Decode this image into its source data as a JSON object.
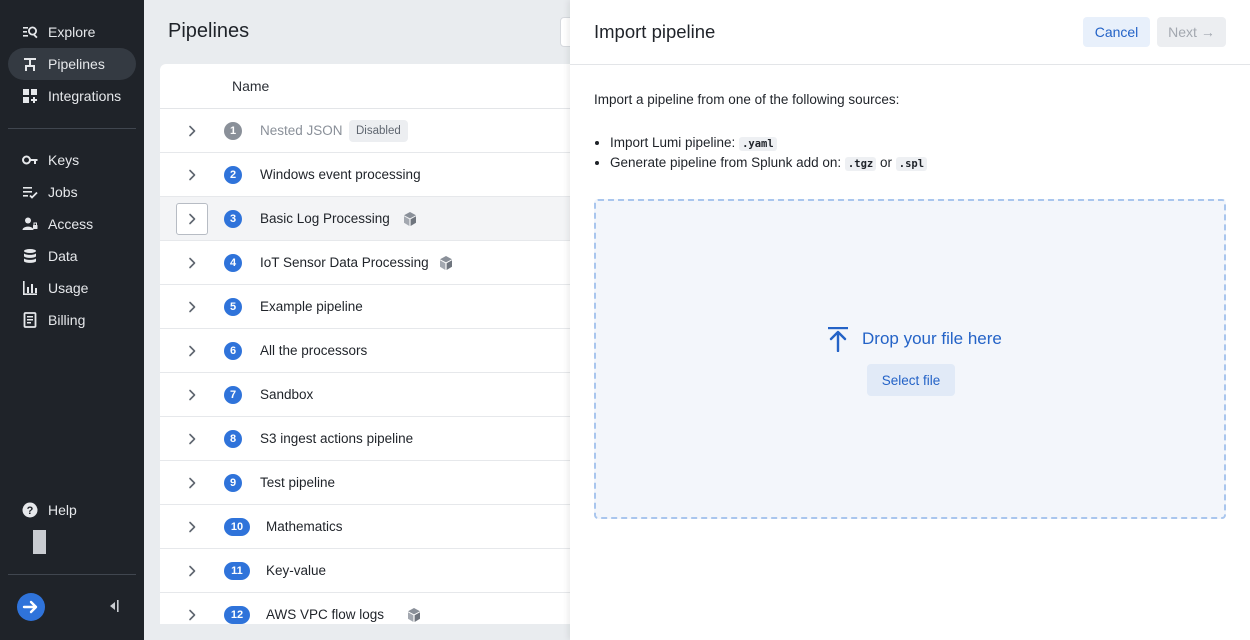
{
  "sidebar": {
    "items": [
      {
        "label": "Explore",
        "icon": "explore-icon"
      },
      {
        "label": "Pipelines",
        "icon": "pipelines-icon",
        "active": true
      },
      {
        "label": "Integrations",
        "icon": "integrations-icon"
      },
      {
        "label": "Keys",
        "icon": "key-icon"
      },
      {
        "label": "Jobs",
        "icon": "jobs-icon"
      },
      {
        "label": "Access",
        "icon": "access-icon"
      },
      {
        "label": "Data",
        "icon": "database-icon"
      },
      {
        "label": "Usage",
        "icon": "bar-chart-icon"
      },
      {
        "label": "Billing",
        "icon": "billing-icon"
      }
    ],
    "help_label": "Help"
  },
  "main": {
    "title": "Pipelines",
    "table": {
      "column_name": "Name",
      "disabled_badge": "Disabled",
      "rows": [
        {
          "num": "1",
          "name": "Nested JSON",
          "disabled": true
        },
        {
          "num": "2",
          "name": "Windows event processing"
        },
        {
          "num": "3",
          "name": "Basic Log Processing",
          "cube": true
        },
        {
          "num": "4",
          "name": "IoT Sensor Data Processing",
          "cube": true
        },
        {
          "num": "5",
          "name": "Example pipeline"
        },
        {
          "num": "6",
          "name": "All the processors"
        },
        {
          "num": "7",
          "name": "Sandbox"
        },
        {
          "num": "8",
          "name": "S3 ingest actions pipeline"
        },
        {
          "num": "9",
          "name": "Test pipeline"
        },
        {
          "num": "10",
          "name": "Mathematics"
        },
        {
          "num": "11",
          "name": "Key-value"
        },
        {
          "num": "12",
          "name": "AWS VPC flow logs",
          "cube": true
        }
      ]
    }
  },
  "drawer": {
    "title": "Import pipeline",
    "cancel_label": "Cancel",
    "next_label": "Next →",
    "intro": "Import a pipeline from one of the following sources:",
    "source1_text": "Import Lumi pipeline:",
    "source1_ext": ".yaml",
    "source2_text": "Generate pipeline from Splunk add on:",
    "source2_ext1": ".tgz",
    "source2_or": "or",
    "source2_ext2": ".spl",
    "drop_text": "Drop your file here",
    "select_label": "Select file"
  },
  "colors": {
    "sidebar_bg": "#1f2329",
    "accent": "#2f73da",
    "link": "#2463c7",
    "dropzone_border": "#a9c6ee"
  }
}
